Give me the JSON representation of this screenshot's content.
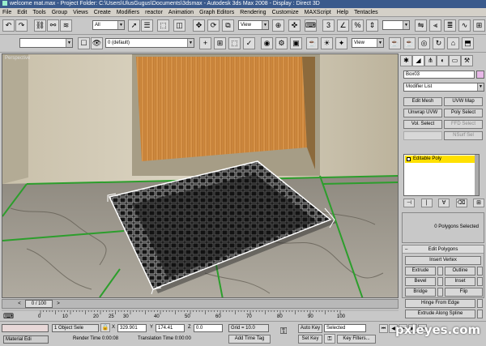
{
  "titlebar": {
    "text": "welcome mat.max    - Project Folder: C:\\Users\\UlusGugus\\Documents\\3dsmax    - Autodesk 3ds Max 2008    - Display : Direct 3D"
  },
  "menu": [
    "File",
    "Edit",
    "Tools",
    "Group",
    "Views",
    "Create",
    "Modifiers",
    "reactor",
    "Animation",
    "Graph Editors",
    "Rendering",
    "Customize",
    "MAXScript",
    "Help",
    "Tentacles"
  ],
  "toolbar1": {
    "selection_filter": "All",
    "ref_coord": "View",
    "ref_coord2": "View",
    "named_sel": ""
  },
  "toolbar2": {
    "layer": "0 (default)",
    "view": "View"
  },
  "viewport": {
    "label": "Perspective"
  },
  "command_panel": {
    "object_name": "Box03",
    "modifier_list": "Modifier List",
    "mod_buttons": [
      "Edit Mesh",
      "UVW Map",
      "Unwrap UVW",
      "Poly Select",
      "Vol. Select",
      "FFD Select",
      "",
      "NSurf Sel"
    ],
    "stack_item": "Editable Poly",
    "selection_info": "0 Polygons Selected",
    "edit_polygons_title": "Edit Polygons",
    "insert_vertex": "Insert Vertex",
    "poly_buttons": [
      "Extrude",
      "Outline",
      "Bevel",
      "Inset",
      "Bridge",
      "Flip"
    ],
    "hinge": "Hinge From Edge",
    "extrude_spline": "Extrude Along Spline"
  },
  "timeslider": {
    "frame": "0 / 100"
  },
  "ruler_ticks": [
    "0",
    "10",
    "20",
    "25",
    "30",
    "40",
    "50",
    "60",
    "70",
    "80",
    "90",
    "100"
  ],
  "status": {
    "maxscript_label": "Material Edi",
    "selection": "1 Object Sele",
    "x_label": "X",
    "x_value": "329.901",
    "y_label": "Y",
    "y_value": "174.41",
    "z_label": "Z",
    "z_value": "0.0",
    "grid": "Grid = 10.0",
    "auto_key": "Auto Key",
    "auto_key_mode": "Selected",
    "set_key": "Set Key",
    "key_filters": "Key Filters...",
    "add_time_tag": "Add Time Tag",
    "render_time": "Render Time  0:00:08",
    "translation_time": "Translation Time  0:00:00"
  },
  "watermark": "pxleyes.com",
  "colors": {
    "titlebar": "#3a5a8c",
    "stack_highlight": "#ffe000",
    "wood": "#d08a3a",
    "mat_dark": "#1a1a1a",
    "green_grid": "#2c9e2c"
  }
}
